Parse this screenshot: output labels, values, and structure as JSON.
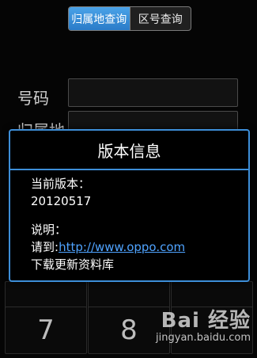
{
  "tabs": [
    {
      "label": "归属地查询",
      "active": true
    },
    {
      "label": "区号查询",
      "active": false
    }
  ],
  "form": {
    "number_label": "号码",
    "location_label": "归属地"
  },
  "dialog": {
    "title": "版本信息",
    "version_label": "当前版本：",
    "version_value": "20120517",
    "note_label": "说明：",
    "note_prefix": "请到:",
    "note_link": "http://www.oppo.com",
    "note_suffix": "下载更新资料库"
  },
  "keypad": {
    "keys": [
      "7",
      "8"
    ]
  },
  "watermark": {
    "brand": "Bai 经验",
    "url": "jingyan.baidu.com"
  },
  "colors": {
    "accent": "#3d8ed8",
    "tab_active": "#2a7bc8",
    "link": "#4fa3ff",
    "background": "#050505"
  }
}
